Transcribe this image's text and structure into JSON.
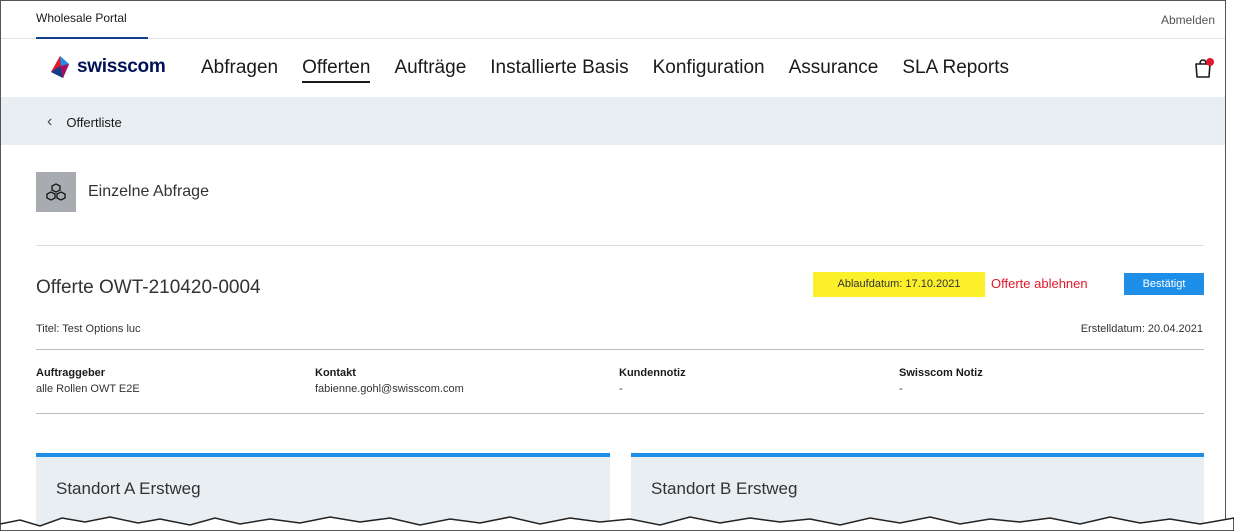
{
  "utilbar": {
    "portal_tab": "Wholesale Portal",
    "logout": "Abmelden"
  },
  "brand": {
    "name": "swisscom",
    "color": "#001155"
  },
  "nav": {
    "items": [
      "Abfragen",
      "Offerten",
      "Aufträge",
      "Installierte Basis",
      "Konfiguration",
      "Assurance",
      "SLA Reports"
    ],
    "active_index": 1
  },
  "breadcrumb": {
    "back_label": "Offertliste"
  },
  "section": {
    "title": "Einzelne Abfrage",
    "icon": "cubes-icon"
  },
  "offer": {
    "title": "Offerte OWT-210420-0004",
    "expiry": "Ablaufdatum: 17.10.2021",
    "decline": "Offerte ablehnen",
    "status": "Bestätigt",
    "subtitle": "Titel: Test Options luc",
    "created": "Erstelldatum: 20.04.2021"
  },
  "info": [
    {
      "label": "Auftraggeber",
      "value": "alle Rollen OWT E2E"
    },
    {
      "label": "Kontakt",
      "value": "fabienne.gohl@swisscom.com"
    },
    {
      "label": "Kundennotiz",
      "value": "-"
    },
    {
      "label": "Swisscom Notiz",
      "value": "-"
    }
  ],
  "cards": [
    {
      "title": "Standort A Erstweg"
    },
    {
      "title": "Standort B Erstweg"
    }
  ],
  "colors": {
    "accent": "#1d8fe8",
    "expiry_highlight": "#fbf02a",
    "decline": "#e3182d",
    "light_bg": "#e8eef2"
  }
}
